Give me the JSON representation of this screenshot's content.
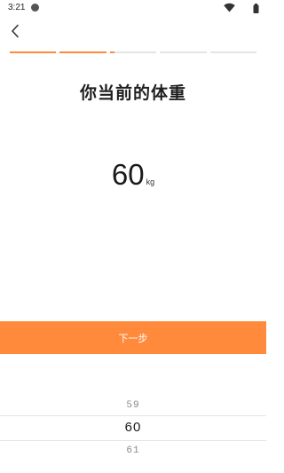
{
  "status_bar": {
    "time": "3:21",
    "icons": [
      "notification-dot-icon",
      "wifi-icon",
      "battery-icon"
    ]
  },
  "header": {
    "back_icon": "chevron-left-icon"
  },
  "progress": {
    "segments": [
      1,
      1,
      0.1,
      0,
      0
    ],
    "accent_color": "#ff8a3c",
    "track_color": "#e4e4e4"
  },
  "page": {
    "title": "你当前的体重",
    "weight_value": "60",
    "weight_unit": "kg"
  },
  "actions": {
    "next_label": "下一步"
  },
  "picker": {
    "prev": "59",
    "selected": "60",
    "next": "61"
  },
  "colors": {
    "accent": "#ff8a3c",
    "background": "#ffffff"
  }
}
